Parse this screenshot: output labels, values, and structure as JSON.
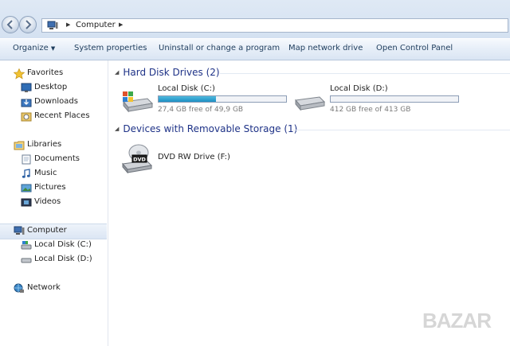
{
  "address": {
    "breadcrumb": "Computer",
    "arrow": "▶",
    "separator": "▶"
  },
  "toolbar": {
    "organize": "Organize",
    "organize_caret": "▼",
    "system_properties": "System properties",
    "uninstall": "Uninstall or change a program",
    "map_drive": "Map network drive",
    "control_panel": "Open Control Panel"
  },
  "nav": {
    "favorites": "Favorites",
    "desktop": "Desktop",
    "downloads": "Downloads",
    "recent_places": "Recent Places",
    "libraries": "Libraries",
    "documents": "Documents",
    "music": "Music",
    "pictures": "Pictures",
    "videos": "Videos",
    "computer": "Computer",
    "local_c": "Local Disk (C:)",
    "local_d": "Local Disk (D:)",
    "network": "Network"
  },
  "groups": {
    "hdd_title": "Hard Disk Drives (2)",
    "removable_title": "Devices with Removable Storage (1)",
    "toggle": "◢"
  },
  "drives": [
    {
      "name": "Local Disk (C:)",
      "free_text": "27,4 GB free of 49,9 GB",
      "used_fraction": 0.45
    },
    {
      "name": "Local Disk (D:)",
      "free_text": "412 GB free of 413 GB",
      "used_fraction": 0.0
    }
  ],
  "dvd": {
    "name": "DVD RW Drive (F:)",
    "icon_label": "DVD"
  },
  "watermark": "BAZAR",
  "colors": {
    "accent_header": "#1e3287",
    "usage_bar": "#2a9ccc",
    "toolbar_text": "#1e3c5c"
  }
}
